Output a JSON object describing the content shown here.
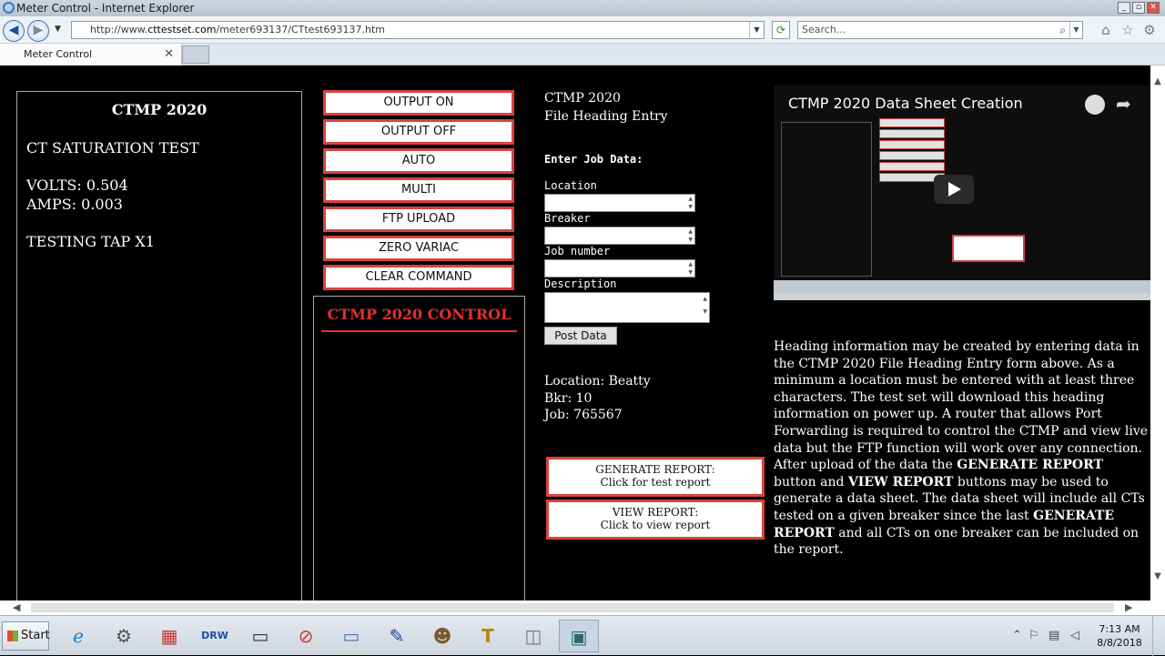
{
  "window": {
    "title": "Meter Control - Internet Explorer"
  },
  "browser": {
    "url_prefix": "http://www.",
    "url_domain": "cttestset.com",
    "url_path": "/meter693137/CTtest693137.htm",
    "search_placeholder": "Search...",
    "tab_label": "Meter Control"
  },
  "status_panel": {
    "title": "CTMP 2020",
    "test_name": "CT SATURATION TEST",
    "volts": "VOLTS: 0.504",
    "amps": "AMPS: 0.003",
    "tap": "TESTING TAP X1"
  },
  "commands": {
    "output_on": "OUTPUT ON",
    "output_off": "OUTPUT OFF",
    "auto": "AUTO",
    "multi": "MULTI",
    "ftp_upload": "FTP UPLOAD",
    "zero_variac": "ZERO VARIAC",
    "clear_command": "CLEAR COMMAND",
    "control_title": "CTMP 2020 CONTROL"
  },
  "form": {
    "heading1": "CTMP 2020",
    "heading2": "File Heading Entry",
    "enter_label": "Enter Job Data:",
    "location_label": "Location",
    "breaker_label": "Breaker",
    "job_label": "Job number",
    "description_label": "Description",
    "post_label": "Post Data",
    "location_info": "Location: Beatty",
    "bkr_info": "Bkr: 10",
    "job_info": "Job: 765567"
  },
  "reports": {
    "generate_title": "GENERATE REPORT:",
    "generate_sub": "Click for test report",
    "view_title": "VIEW REPORT:",
    "view_sub": "Click to view report"
  },
  "video": {
    "title": "CTMP 2020 Data Sheet Creation"
  },
  "info": {
    "p1": "Heading information may be created by entering data in the CTMP 2020 File Heading Entry form above. As a minimum a location must be entered with at least three characters. The test set will download this heading information on power up. A router that allows Port Forwarding is required to control the CTMP and view live data but the FTP function will work over any connection. After upload of the data the ",
    "b1": "GENERATE REPORT",
    "p2": " button and ",
    "b2": "VIEW REPORT",
    "p3": " buttons may be used to generate a data sheet. The data sheet will include all CTs tested on a given breaker since the last ",
    "b3": "GENERATE REPORT",
    "p4": " and all CTs on one breaker can be included on the report."
  },
  "taskbar": {
    "start": "Start",
    "time": "7:13 AM",
    "date": "8/8/2018"
  }
}
